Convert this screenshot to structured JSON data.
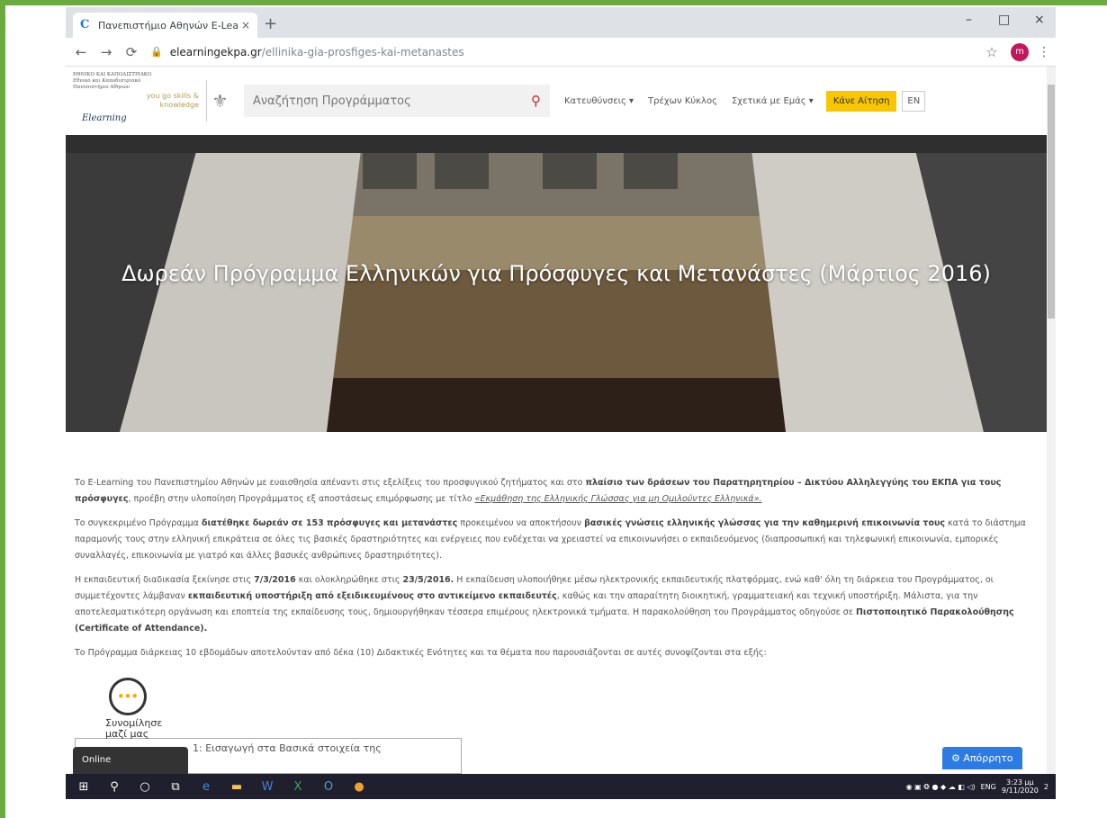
{
  "browser": {
    "tab_title": "Πανεπιστήμιο Αθηνών E-Learning",
    "tab_close": "×",
    "new_tab": "+",
    "url_host": "elearningekpa.gr",
    "url_path": "/ellinika-gia-prosfiges-kai-metanastes",
    "profile_initial": "m",
    "minimize": "–",
    "maximize": "□",
    "close": "×"
  },
  "header": {
    "logo_lines": [
      "ΕΘΝΙΚΟ ΚΑΙ ΚΑΠΟΔΙΣΤΡΙΑΚΟ",
      "Εθνικό και Καποδιστριακό",
      "Πανεπιστήμιο Αθηνών"
    ],
    "logo_elearning": "Elearning",
    "tagline": "you go skills & knowledge",
    "search_placeholder": "Αναζήτηση Προγράμματος",
    "nav": [
      {
        "label": "Κατευθύνσεις ▾"
      },
      {
        "label": "Τρέχων Κύκλος"
      },
      {
        "label": "Σχετικά με Εμάς ▾"
      }
    ],
    "cta_label": "Κάνε Αίτηση",
    "lang_label": "EN"
  },
  "hero": {
    "title": "Δωρεάν Πρόγραμμα Ελληνικών για Πρόσφυγες και Μετανάστες (Μάρτιος 2016)"
  },
  "content": {
    "p1_a": "Το E-Learning του Πανεπιστημίου Αθηνών με ευαισθησία απέναντι στις εξελίξεις του προσφυγικού ζητήματος και στο ",
    "p1_b": "πλαίσιο των δράσεων του Παρατηρητηρίου – Δικτύου Αλληλεγγύης του ΕΚΠΑ για τους πρόσφυγες",
    "p1_c": ", προέβη στην υλοποίηση Προγράμματος εξ αποστάσεως επιμόρφωσης με τίτλο ",
    "p1_d": "«Εκμάθηση της Ελληνικής Γλώσσας για μη Ομιλούντες Ελληνικά».",
    "p2_a": "Το συγκεκριμένο Πρόγραμμα ",
    "p2_b": "διατέθηκε δωρεάν σε 153 πρόσφυγες και μετανάστες",
    "p2_c": " προκειμένου να αποκτήσουν ",
    "p2_d": "βασικές γνώσεις ελληνικής γλώσσας για την καθημερινή επικοινωνία τους",
    "p2_e": " κατά το διάστημα παραμονής τους στην ελληνική επικράτεια σε όλες τις βασικές δραστηριότητες και ενέργειες που ενδέχεται να χρειαστεί να επικοινωνήσει ο εκπαιδευόμενος (διαπροσωπική και τηλεφωνική επικοινωνία, εμπορικές συναλλαγές, επικοινωνία με γιατρό και άλλες βασικές ανθρώπινες δραστηριότητες).",
    "p3_a": "Η εκπαιδευτική διαδικασία ξεκίνησε στις ",
    "p3_b": "7/3/2016",
    "p3_c": " και ολοκληρώθηκε στις ",
    "p3_d": "23/5/2016.",
    "p3_e": " Η εκπαίδευση υλοποιήθηκε μέσω ηλεκτρονικής εκπαιδευτικής πλατφόρμας, ενώ καθ' όλη τη διάρκεια του Προγράμματος, οι συμμετέχοντες λάμβαναν ",
    "p3_f": "εκπαιδευτική υποστήριξη από εξειδικευμένους στο αντικείμενο εκπαιδευτές",
    "p3_g": ", καθώς και την απαραίτητη διοικητική, γραμματειακή και τεχνική υποστήριξη. Μάλιστα, για την αποτελεσματικότερη οργάνωση και εποπτεία της εκπαίδευσης τους, δημιουργήθηκαν τέσσερα επιμέρους ηλεκτρονικά τμήματα. Η παρακολούθηση του Προγράμματος οδηγούσε σε ",
    "p3_h": "Πιστοποιητικό Παρακολούθησης (Certificate of Attendance).",
    "p4": "Το Πρόγραμμα διάρκειας 10 εβδομάδων αποτελούνταν από δέκα (10) Διδακτικές Ενότητες και τα θέματα που παρουσιάζονται σε αυτές συνοψίζονται στα εξής:",
    "module1": "1: Εισαγωγή στα Βασικά στοιχεία της"
  },
  "widgets": {
    "chat_dots": "•••",
    "chat_label": "Συνομίλησε μαζί μας",
    "online_label": "Online",
    "privacy_label": "⚙ Απόρρητο"
  },
  "taskbar": {
    "lang": "ENG",
    "time": "3:23 μμ",
    "date": "9/11/2020",
    "notif_count": "2"
  }
}
